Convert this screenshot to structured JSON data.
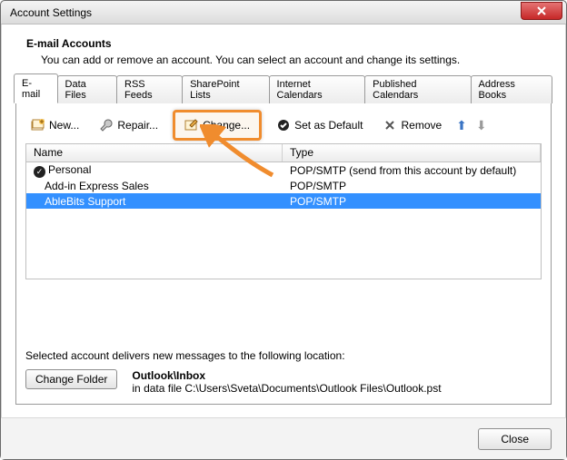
{
  "window": {
    "title": "Account Settings"
  },
  "header": {
    "heading": "E-mail Accounts",
    "subtext": "You can add or remove an account. You can select an account and change its settings."
  },
  "tabs": [
    {
      "label": "E-mail",
      "active": true
    },
    {
      "label": "Data Files"
    },
    {
      "label": "RSS Feeds"
    },
    {
      "label": "SharePoint Lists"
    },
    {
      "label": "Internet Calendars"
    },
    {
      "label": "Published Calendars"
    },
    {
      "label": "Address Books"
    }
  ],
  "toolbar": {
    "new_label": "New...",
    "repair_label": "Repair...",
    "change_label": "Change...",
    "default_label": "Set as Default",
    "remove_label": "Remove"
  },
  "table": {
    "columns": {
      "name": "Name",
      "type": "Type"
    },
    "rows": [
      {
        "name": "Personal",
        "type": "POP/SMTP (send from this account by default)",
        "default": true,
        "selected": false
      },
      {
        "name": "Add-in Express Sales",
        "type": "POP/SMTP",
        "default": false,
        "selected": false
      },
      {
        "name": "AbleBits Support",
        "type": "POP/SMTP",
        "default": false,
        "selected": true
      }
    ]
  },
  "delivery": {
    "label": "Selected account delivers new messages to the following location:",
    "button": "Change Folder",
    "folder": "Outlook\\Inbox",
    "path": "in data file C:\\Users\\Sveta\\Documents\\Outlook Files\\Outlook.pst"
  },
  "footer": {
    "close": "Close"
  }
}
